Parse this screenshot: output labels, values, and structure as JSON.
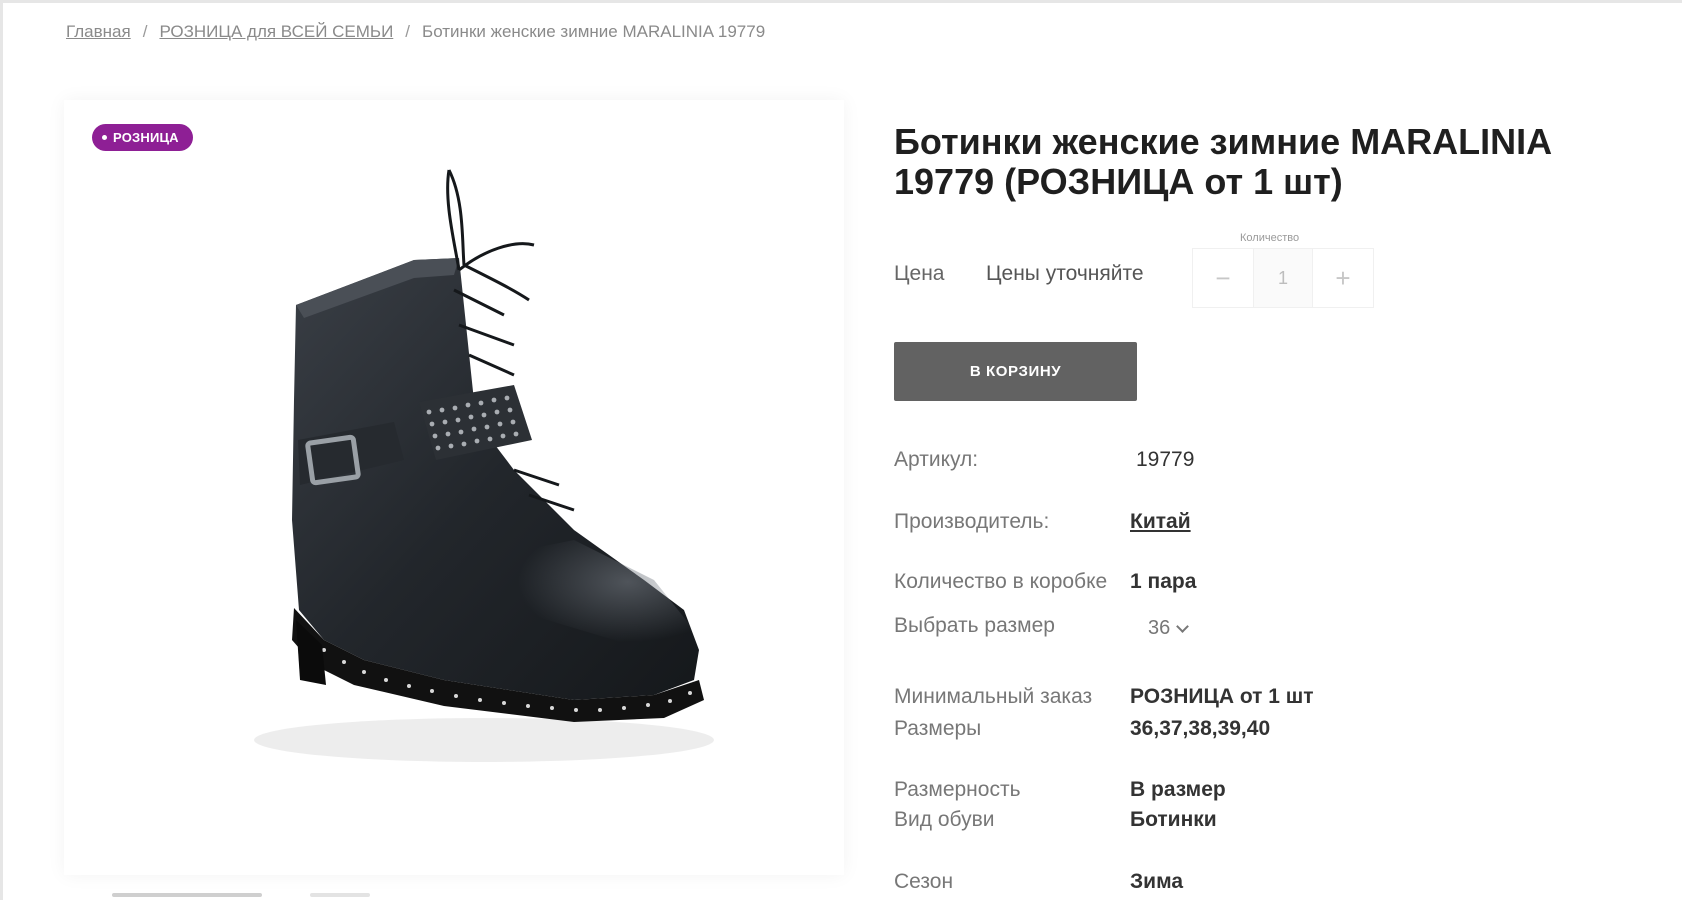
{
  "breadcrumb": {
    "items": [
      "Главная",
      "РОЗНИЦА для ВСЕЙ СЕМЬИ"
    ],
    "current": "Ботинки женские зимние MARALINIA 19779",
    "separator": "/"
  },
  "badge": {
    "label": "РОЗНИЦА",
    "color": "#8e1f95"
  },
  "product": {
    "title": "Ботинки женские зимние MARALINIA 19779 (РОЗНИЦА от 1 шт)",
    "price_label": "Цена",
    "price_value": "Цены уточняйте",
    "quantity_label": "Количество",
    "quantity_value": "1",
    "minus_symbol": "−",
    "plus_symbol": "+",
    "cart_button": "В КОРЗИНУ"
  },
  "specs": {
    "article": {
      "label": "Артикул:",
      "value": "19779"
    },
    "manufacturer": {
      "label": "Производитель:",
      "value": "Китай"
    },
    "box_qty": {
      "label": "Количество в коробке",
      "value": "1 пара"
    },
    "size_select": {
      "label": "Выбрать размер",
      "value": "36"
    },
    "min_order": {
      "label": "Минимальный заказ",
      "value": "РОЗНИЦА от 1 шт"
    },
    "sizes": {
      "label": "Размеры",
      "value": "36,37,38,39,40"
    },
    "sizing": {
      "label": "Размерность",
      "value": "В размер"
    },
    "shoe_type": {
      "label": "Вид обуви",
      "value": "Ботинки"
    },
    "season": {
      "label": "Сезон",
      "value": "Зима"
    }
  },
  "colors": {
    "cart_button": "#626262",
    "badge": "#8e1f95"
  }
}
